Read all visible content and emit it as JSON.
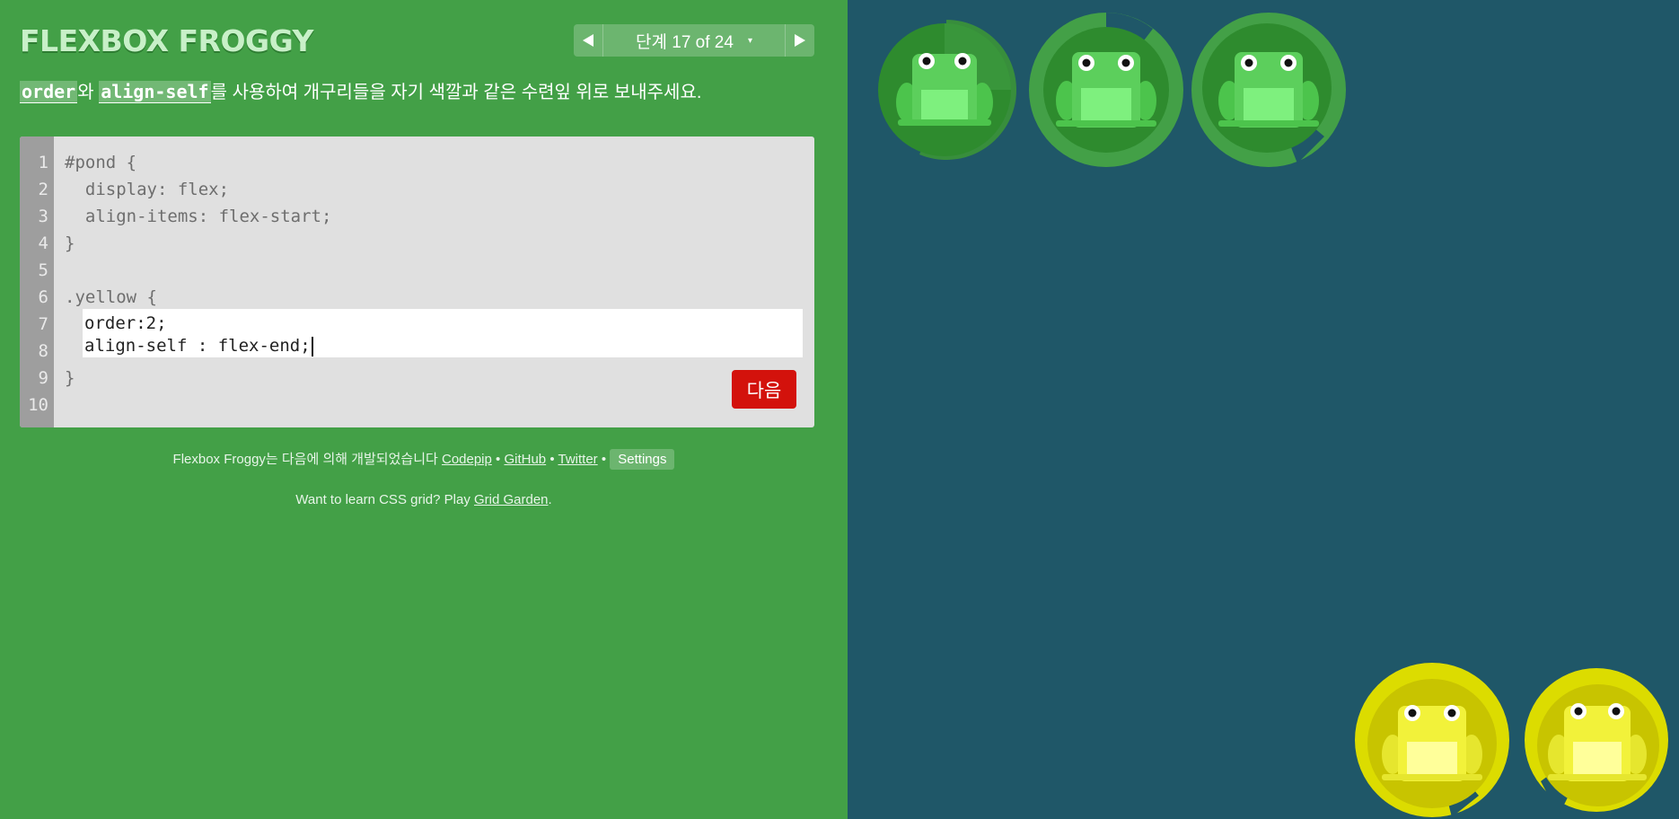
{
  "app": {
    "title": "FLEXBOX FROGGY",
    "level_label": "단계 17 of 24",
    "caret": "▾"
  },
  "instructions": {
    "tag1": "order",
    "connector": "와 ",
    "tag2": "align-self",
    "rest": "를 사용하여 개구리들을 자기 색깔과 같은 수련잎 위로 보내주세요."
  },
  "editor": {
    "line_numbers": [
      "1",
      "2",
      "3",
      "4",
      "5",
      "6",
      "7",
      "8",
      "9",
      "10"
    ],
    "lines": [
      "#pond {",
      "  display: flex;",
      "  align-items: flex-start;",
      "}",
      "",
      ".yellow {",
      "",
      "",
      "}",
      ""
    ],
    "input_lines": [
      "order:2;",
      "align-self : flex-end;"
    ],
    "next_label": "다음"
  },
  "footer": {
    "credits_prefix": "Flexbox Froggy는 다음에 의해 개발되었습니다 ",
    "codepip": "Codepip",
    "sep": " • ",
    "github": "GitHub",
    "twitter": "Twitter",
    "settings": "Settings",
    "grid_prefix": "Want to learn CSS grid? Play ",
    "grid_link": "Grid Garden",
    "grid_suffix": "."
  },
  "colors": {
    "sidebar": "#43a047",
    "pond": "#1f5768",
    "green_lily": "#2e8b34",
    "green_frog": "#5ccf5c",
    "yellow_lily": "#c8c400",
    "yellow_frog": "#f2f23a",
    "next_button": "#d3120c"
  },
  "pond": {
    "frogs": [
      {
        "color": "green",
        "icon": "frog-icon"
      },
      {
        "color": "green",
        "icon": "frog-icon"
      },
      {
        "color": "green",
        "icon": "frog-icon"
      }
    ],
    "lilypads": [
      {
        "color": "yellow",
        "icon": "lilypad-icon"
      },
      {
        "color": "yellow",
        "icon": "lilypad-icon"
      }
    ]
  }
}
